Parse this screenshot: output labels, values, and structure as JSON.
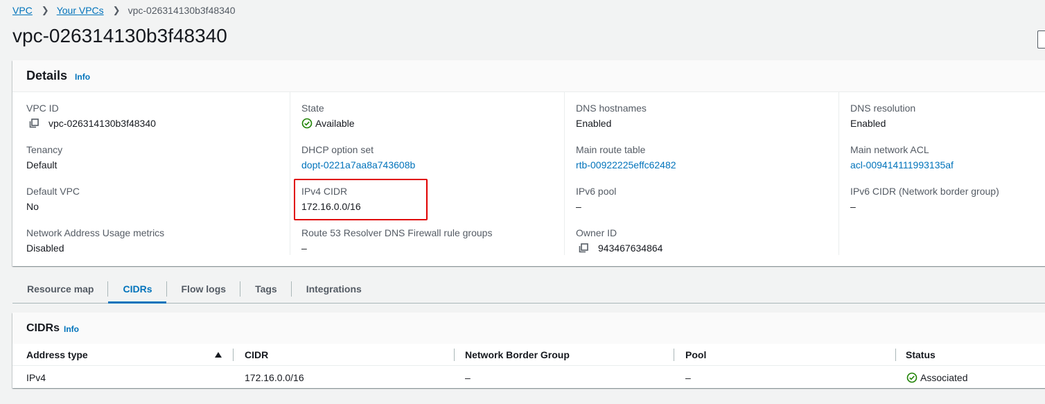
{
  "breadcrumb": {
    "items": [
      "VPC",
      "Your VPCs"
    ],
    "current": "vpc-026314130b3f48340"
  },
  "page": {
    "title": "vpc-026314130b3f48340"
  },
  "details": {
    "title": "Details",
    "info": "Info",
    "col1": [
      {
        "key": "VPC ID",
        "value": "vpc-026314130b3f48340"
      },
      {
        "key": "Tenancy",
        "value": "Default"
      },
      {
        "key": "Default VPC",
        "value": "No"
      },
      {
        "key": "Network Address Usage metrics",
        "value": "Disabled"
      }
    ],
    "col2": [
      {
        "key": "State",
        "value": "Available"
      },
      {
        "key": "DHCP option set",
        "value": "dopt-0221a7aa8a743608b"
      },
      {
        "key": "IPv4 CIDR",
        "value": "172.16.0.0/16"
      },
      {
        "key": "Route 53 Resolver DNS Firewall rule groups",
        "value": "–"
      }
    ],
    "col3": [
      {
        "key": "DNS hostnames",
        "value": "Enabled"
      },
      {
        "key": "Main route table",
        "value": "rtb-00922225effc62482"
      },
      {
        "key": "IPv6 pool",
        "value": "–"
      },
      {
        "key": "Owner ID",
        "value": "943467634864"
      }
    ],
    "col4": [
      {
        "key": "DNS resolution",
        "value": "Enabled"
      },
      {
        "key": "Main network ACL",
        "value": "acl-009414111993135af"
      },
      {
        "key": "IPv6 CIDR (Network border group)",
        "value": "–"
      }
    ]
  },
  "tabs": [
    "Resource map",
    "CIDRs",
    "Flow logs",
    "Tags",
    "Integrations"
  ],
  "cidrs": {
    "title": "CIDRs",
    "info": "Info",
    "columns": [
      "Address type",
      "CIDR",
      "Network Border Group",
      "Pool",
      "Status"
    ],
    "rows": [
      {
        "address_type": "IPv4",
        "cidr": "172.16.0.0/16",
        "border_group": "–",
        "pool": "–",
        "status": "Associated"
      }
    ]
  },
  "colors": {
    "link": "#0073bb",
    "success": "#1d8102",
    "highlight": "#e00000"
  }
}
